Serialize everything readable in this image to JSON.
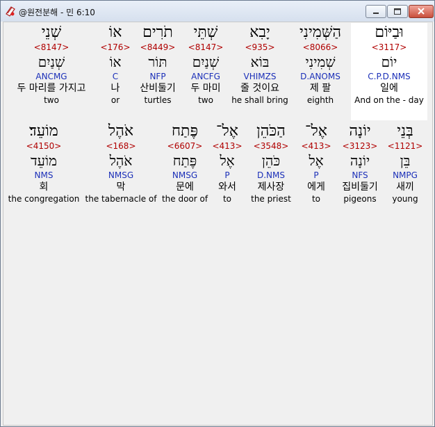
{
  "window": {
    "title": "@원전분해 - 민 6:10",
    "app_icon": "bible-book-icon"
  },
  "row1": [
    {
      "hebrew": "וּבַיּוֹם",
      "strong": "<3117>",
      "lemma": "יוֹם",
      "morph": "C.P.D.NMS",
      "korean": "일에",
      "english": "And on the - day",
      "highlighted": true
    },
    {
      "hebrew": "הַשְּׁמִינִי",
      "strong": "<8066>",
      "lemma": "שְׁמִינִי",
      "morph": "D.ANOMS",
      "korean": "제 팔",
      "english": "eighth"
    },
    {
      "hebrew": "יָבִא",
      "strong": "<935>",
      "lemma": "בּוֹא",
      "morph": "VHIMZS",
      "korean": "줄 것이요",
      "english": "he shall bring"
    },
    {
      "hebrew": "שְׁתֵּי",
      "strong": "<8147>",
      "lemma": "שְׁנַיִם",
      "morph": "ANCFG",
      "korean": "두 마미",
      "english": "two"
    },
    {
      "hebrew": "תֹרִים",
      "strong": "<8449>",
      "lemma": "תּוֹר",
      "morph": "NFP",
      "korean": "산비둘기",
      "english": "turtles"
    },
    {
      "hebrew": "אוֹ",
      "strong": "<176>",
      "lemma": "אוֹ",
      "morph": "C",
      "korean": "나",
      "english": "or"
    },
    {
      "hebrew": "שְׁנֵי",
      "strong": "<8147>",
      "lemma": "שְׁנַיִם",
      "morph": "ANCMG",
      "korean": "두 마리를 가지고",
      "english": "two"
    }
  ],
  "row2": [
    {
      "hebrew": "בְּנֵי",
      "strong": "<1121>",
      "lemma": "בֵּן",
      "morph": "NMPG",
      "korean": "새끼",
      "english": "young"
    },
    {
      "hebrew": "יוֹנָה",
      "strong": "<3123>",
      "lemma": "יוֹנָה",
      "morph": "NFS",
      "korean": "집비둘기",
      "english": "pigeons"
    },
    {
      "hebrew": "אֶל־",
      "strong": "<413>",
      "lemma": "אֶל",
      "morph": "P",
      "korean": "에게",
      "english": "to"
    },
    {
      "hebrew": "הַכֹּהֵן",
      "strong": "<3548>",
      "lemma": "כֹּהֵן",
      "morph": "D.NMS",
      "korean": "제사장",
      "english": "the priest"
    },
    {
      "hebrew": "אֶל־",
      "strong": "<413>",
      "lemma": "אֶל",
      "morph": "P",
      "korean": "와서",
      "english": "to"
    },
    {
      "hebrew": "פֶּתַח",
      "strong": "<6607>",
      "lemma": "פֶּתַח",
      "morph": "NMSG",
      "korean": "문에",
      "english": "the door of"
    },
    {
      "hebrew": "אֹהֶל",
      "strong": "<168>",
      "lemma": "אֹהֶל",
      "morph": "NMSG",
      "korean": "막",
      "english": "the tabernacle of"
    },
    {
      "hebrew": "מוֹעֵד׃",
      "strong": "<4150>",
      "lemma": "מוֹעֵד",
      "morph": "NMS",
      "korean": "회",
      "english": "the congregation"
    }
  ]
}
